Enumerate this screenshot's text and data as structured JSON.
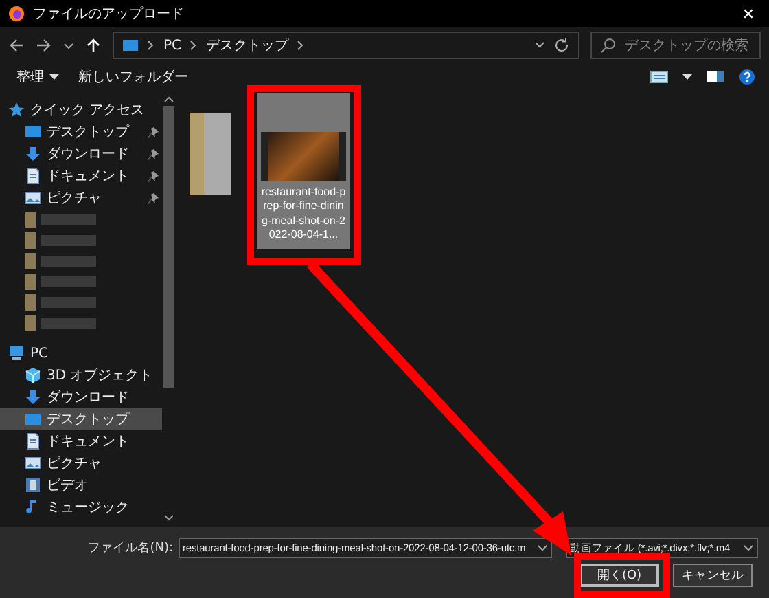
{
  "window": {
    "title": "ファイルのアップロード",
    "close": "✕"
  },
  "nav": {
    "path": [
      {
        "label": "PC"
      },
      {
        "label": "デスクトップ"
      }
    ],
    "search": {
      "placeholder": "デスクトップの検索"
    }
  },
  "toolbar": {
    "organize": "整理",
    "new_folder": "新しいフォルダー"
  },
  "sidebar": {
    "items": [
      {
        "label": "クイック アクセス",
        "selected": false,
        "children": [
          {
            "label": "デスクトップ",
            "pinned": true,
            "selected": false
          },
          {
            "label": "ダウンロード",
            "pinned": true,
            "selected": false
          },
          {
            "label": "ドキュメント",
            "pinned": true,
            "selected": false
          },
          {
            "label": "ピクチャ",
            "pinned": true,
            "selected": false
          },
          {
            "kind": "blurred"
          },
          {
            "kind": "blurred"
          },
          {
            "kind": "blurred"
          },
          {
            "kind": "blurred"
          },
          {
            "kind": "blurred"
          },
          {
            "kind": "blurred"
          }
        ]
      },
      {
        "label": "PC",
        "selected": false,
        "children": [
          {
            "label": "3D オブジェクト",
            "selected": false
          },
          {
            "label": "ダウンロード",
            "selected": false
          },
          {
            "label": "デスクトップ",
            "selected": true
          },
          {
            "label": "ドキュメント",
            "selected": false
          },
          {
            "label": "ピクチャ",
            "selected": false
          },
          {
            "label": "ビデオ",
            "selected": false
          },
          {
            "label": "ミュージック",
            "selected": false
          }
        ]
      }
    ]
  },
  "files": [
    {
      "kind": "blurred",
      "selected": false
    },
    {
      "kind": "video",
      "name": "restaurant-food-prep-for-fine-dining-meal-shot-on-2022-08-04-1...",
      "selected": true
    }
  ],
  "bottom": {
    "filename_label": "ファイル名(N):",
    "filename": "restaurant-food-prep-for-fine-dining-meal-shot-on-2022-08-04-12-00-36-utc.m",
    "filter": "動画ファイル (*.avi;*.divx;*.flv;*.m4",
    "buttons": [
      {
        "label": "開く(O)",
        "kind": "primary"
      },
      {
        "label": "キャンセル",
        "kind": "normal"
      }
    ]
  }
}
